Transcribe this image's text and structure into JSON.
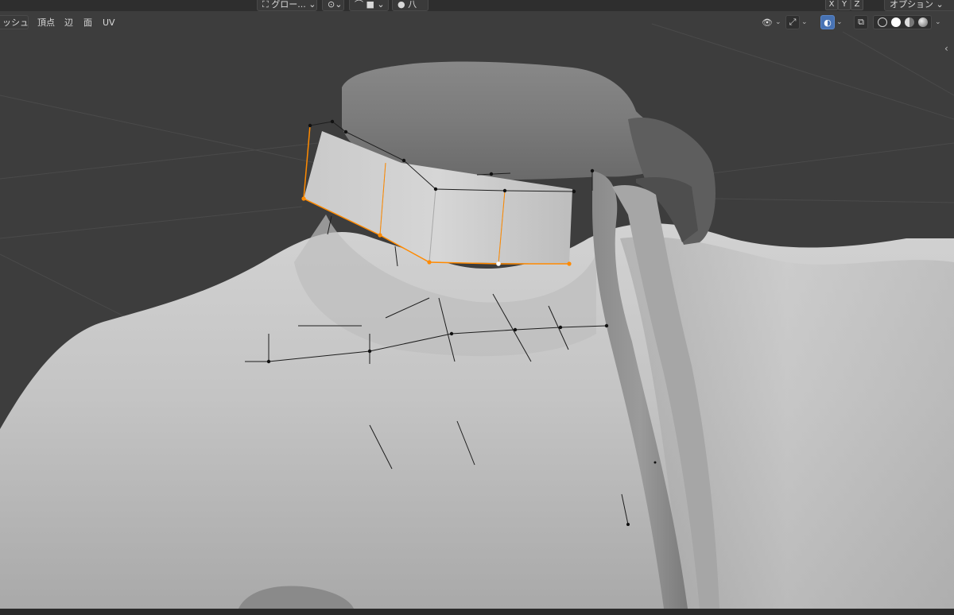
{
  "app": "Blender",
  "top_header": {
    "transform_orientation": "グロー...",
    "proportional_label": "八"
  },
  "select_modes": {
    "mesh_menu": "ッシュ",
    "vertex": "頂点",
    "edge": "辺",
    "face": "面",
    "uv": "UV"
  },
  "mirror_axes": [
    "X",
    "Y",
    "Z"
  ],
  "options_label": "オプション",
  "colors": {
    "viewport_bg": "#3d3d3d",
    "selection": "#ff8a00",
    "active_highlight": "#4772b3"
  },
  "icons": [
    "orientation-icon",
    "pivot-icon",
    "snap-icon",
    "proportional-icon",
    "visibility-icon",
    "gizmo-icon",
    "overlay-icon",
    "xray-icon",
    "wireframe-shading-icon",
    "solid-shading-icon",
    "material-shading-icon",
    "rendered-shading-icon"
  ]
}
